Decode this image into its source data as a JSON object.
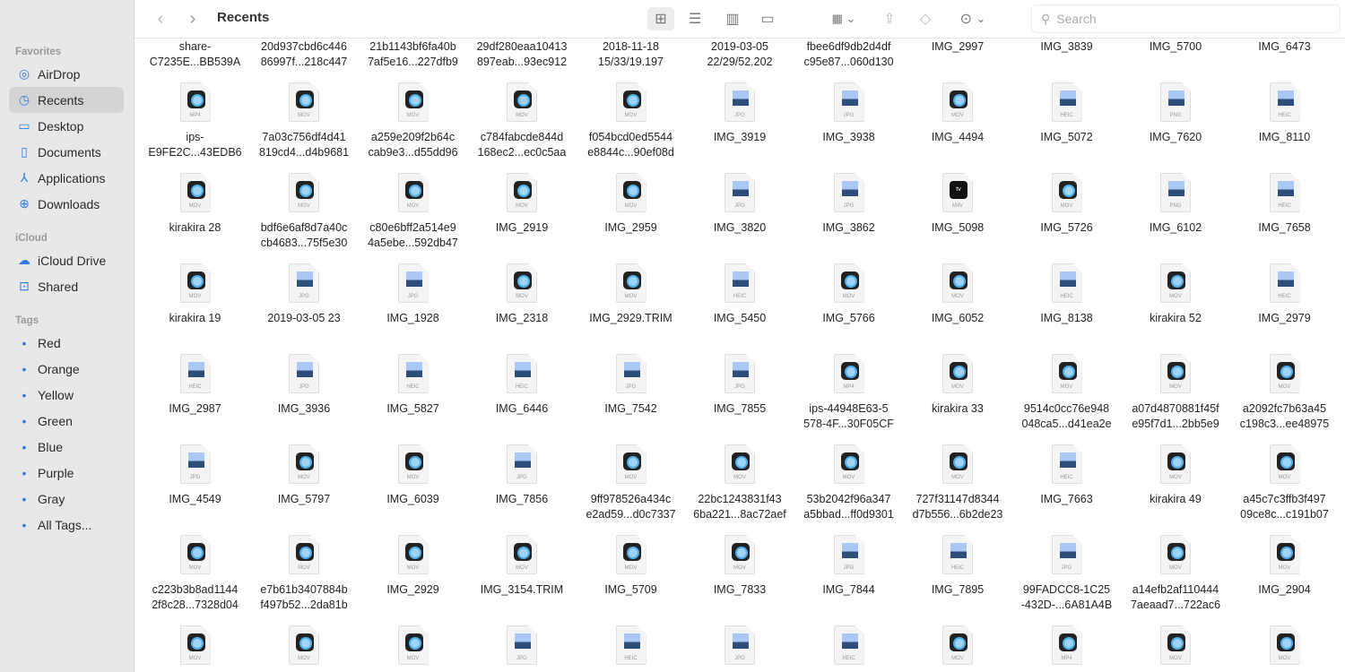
{
  "toolbar": {
    "title": "Recents",
    "search_placeholder": "Search"
  },
  "sidebar": {
    "favorites_label": "Favorites",
    "favorites": [
      {
        "label": "AirDrop",
        "icon": "airdrop-icon"
      },
      {
        "label": "Recents",
        "icon": "clock-icon",
        "selected": true
      },
      {
        "label": "Desktop",
        "icon": "desktop-icon"
      },
      {
        "label": "Documents",
        "icon": "document-icon"
      },
      {
        "label": "Applications",
        "icon": "applications-icon"
      },
      {
        "label": "Downloads",
        "icon": "download-icon"
      }
    ],
    "icloud_label": "iCloud",
    "icloud": [
      {
        "label": "iCloud Drive",
        "icon": "cloud-icon"
      },
      {
        "label": "Shared",
        "icon": "shared-folder-icon"
      }
    ],
    "tags_label": "Tags",
    "tags": [
      {
        "label": "Red",
        "color": "#f0443a"
      },
      {
        "label": "Orange",
        "color": "#f29a1b"
      },
      {
        "label": "Yellow",
        "color": "#f4c51d"
      },
      {
        "label": "Green",
        "color": "#2dbb48"
      },
      {
        "label": "Blue",
        "color": "#2f7be6"
      },
      {
        "label": "Purple",
        "color": "#a24fd0"
      },
      {
        "label": "Gray",
        "color": "#8c8c8c"
      },
      {
        "label": "All Tags...",
        "color": null
      }
    ]
  },
  "files": [
    [
      {
        "name": [
          "share-",
          "C7235E...BB539A"
        ]
      },
      {
        "name": [
          "20d937cbd6c446",
          "86997f...218c447"
        ]
      },
      {
        "name": [
          "21b1143bf6fa40b",
          "7af5e16...227dfb9"
        ]
      },
      {
        "name": [
          "29df280eaa10413",
          "897eab...93ec912"
        ]
      },
      {
        "name": [
          "2018-11-18",
          "15/33/19.197"
        ]
      },
      {
        "name": [
          "2019-03-05",
          "22/29/52.202"
        ]
      },
      {
        "name": [
          "fbee6df9db2d4df",
          "c95e87...060d130"
        ]
      },
      {
        "name": [
          "IMG_2997"
        ]
      },
      {
        "name": [
          "IMG_3839"
        ]
      },
      {
        "name": [
          "IMG_5700"
        ]
      },
      {
        "name": [
          "IMG_6473"
        ]
      }
    ],
    [
      {
        "name": [
          "ips-",
          "E9FE2C...43EDB6"
        ],
        "type": "MP4"
      },
      {
        "name": [
          "7a03c756df4d41",
          "819cd4...d4b9681"
        ],
        "type": "MOV"
      },
      {
        "name": [
          "a259e209f2b64c",
          "cab9e3...d55dd96"
        ],
        "type": "MOV"
      },
      {
        "name": [
          "c784fabcde844d",
          "168ec2...ec0c5aa"
        ],
        "type": "MOV"
      },
      {
        "name": [
          "f054bcd0ed5544",
          "e8844c...90ef08d"
        ],
        "type": "MOV"
      },
      {
        "name": [
          "IMG_3919"
        ],
        "type": "JPG"
      },
      {
        "name": [
          "IMG_3938"
        ],
        "type": "JPG"
      },
      {
        "name": [
          "IMG_4494"
        ],
        "type": "MOV"
      },
      {
        "name": [
          "IMG_5072"
        ],
        "type": "HEIC"
      },
      {
        "name": [
          "IMG_7620"
        ],
        "type": "PNG"
      },
      {
        "name": [
          "IMG_8110"
        ],
        "type": "HEIC"
      }
    ],
    [
      {
        "name": [
          "kirakira 28"
        ],
        "type": "MOV"
      },
      {
        "name": [
          "bdf6e6af8d7a40c",
          "cb4683...75f5e30"
        ],
        "type": "MOV"
      },
      {
        "name": [
          "c80e6bff2a514e9",
          "4a5ebe...592db47"
        ],
        "type": "MOV"
      },
      {
        "name": [
          "IMG_2919"
        ],
        "type": "MOV"
      },
      {
        "name": [
          "IMG_2959"
        ],
        "type": "MOV"
      },
      {
        "name": [
          "IMG_3820"
        ],
        "type": "JPG"
      },
      {
        "name": [
          "IMG_3862"
        ],
        "type": "JPG"
      },
      {
        "name": [
          "IMG_5098"
        ],
        "type": "M4V"
      },
      {
        "name": [
          "IMG_5726"
        ],
        "type": "MOV"
      },
      {
        "name": [
          "IMG_6102"
        ],
        "type": "PNG"
      },
      {
        "name": [
          "IMG_7658"
        ],
        "type": "HEIC"
      }
    ],
    [
      {
        "name": [
          "kirakira 19"
        ],
        "type": "MOV"
      },
      {
        "name": [
          "2019-03-05 23"
        ],
        "type": "JPG"
      },
      {
        "name": [
          "IMG_1928"
        ],
        "type": "JPG"
      },
      {
        "name": [
          "IMG_2318"
        ],
        "type": "MOV"
      },
      {
        "name": [
          "IMG_2929.TRIM"
        ],
        "type": "MOV"
      },
      {
        "name": [
          "IMG_5450"
        ],
        "type": "HEIC"
      },
      {
        "name": [
          "IMG_5766"
        ],
        "type": "MOV"
      },
      {
        "name": [
          "IMG_6052"
        ],
        "type": "MOV"
      },
      {
        "name": [
          "IMG_8138"
        ],
        "type": "HEIC"
      },
      {
        "name": [
          "kirakira 52"
        ],
        "type": "MOV"
      },
      {
        "name": [
          "IMG_2979"
        ],
        "type": "HEIC"
      }
    ],
    [
      {
        "name": [
          "IMG_2987"
        ],
        "type": "HEIC"
      },
      {
        "name": [
          "IMG_3936"
        ],
        "type": "JPG"
      },
      {
        "name": [
          "IMG_5827"
        ],
        "type": "HEIC"
      },
      {
        "name": [
          "IMG_6446"
        ],
        "type": "HEIC"
      },
      {
        "name": [
          "IMG_7542"
        ],
        "type": "JPG"
      },
      {
        "name": [
          "IMG_7855"
        ],
        "type": "JPG"
      },
      {
        "name": [
          "ips-44948E63-5",
          "578-4F...30F05CF"
        ],
        "type": "MP4"
      },
      {
        "name": [
          "kirakira 33"
        ],
        "type": "MOV"
      },
      {
        "name": [
          "9514c0cc76e948",
          "048ca5...d41ea2e"
        ],
        "type": "MOV"
      },
      {
        "name": [
          "a07d4870881f45f",
          "e95f7d1...2bb5e9"
        ],
        "type": "MOV"
      },
      {
        "name": [
          "a2092fc7b63a45",
          "c198c3...ee48975"
        ],
        "type": "MOV"
      }
    ],
    [
      {
        "name": [
          "IMG_4549"
        ],
        "type": "JPG"
      },
      {
        "name": [
          "IMG_5797"
        ],
        "type": "MOV"
      },
      {
        "name": [
          "IMG_6039"
        ],
        "type": "MOV"
      },
      {
        "name": [
          "IMG_7856"
        ],
        "type": "JPG"
      },
      {
        "name": [
          "9ff978526a434c",
          "e2ad59...d0c7337"
        ],
        "type": "MOV"
      },
      {
        "name": [
          "22bc1243831f43",
          "6ba221...8ac72aef"
        ],
        "type": "MOV"
      },
      {
        "name": [
          "53b2042f96a347",
          "a5bbad...ff0d9301"
        ],
        "type": "MOV"
      },
      {
        "name": [
          "727f31147d8344",
          "d7b556...6b2de23"
        ],
        "type": "MOV"
      },
      {
        "name": [
          "IMG_7663"
        ],
        "type": "HEIC"
      },
      {
        "name": [
          "kirakira 49"
        ],
        "type": "MOV"
      },
      {
        "name": [
          "a45c7c3ffb3f497",
          "09ce8c...c191b07"
        ],
        "type": "MOV"
      }
    ],
    [
      {
        "name": [
          "c223b3b8ad1144",
          "2f8c28...7328d04"
        ],
        "type": "MOV"
      },
      {
        "name": [
          "e7b61b3407884b",
          "f497b52...2da81b"
        ],
        "type": "MOV"
      },
      {
        "name": [
          "IMG_2929"
        ],
        "type": "MOV"
      },
      {
        "name": [
          "IMG_3154.TRIM"
        ],
        "type": "MOV"
      },
      {
        "name": [
          "IMG_5709"
        ],
        "type": "MOV"
      },
      {
        "name": [
          "IMG_7833"
        ],
        "type": "MOV"
      },
      {
        "name": [
          "IMG_7844"
        ],
        "type": "JPG"
      },
      {
        "name": [
          "IMG_7895"
        ],
        "type": "HEIC"
      },
      {
        "name": [
          "99FADCC8-1C25",
          "-432D-...6A81A4B"
        ],
        "type": "JPG"
      },
      {
        "name": [
          "a14efb2af110444",
          "7aeaad7...722ac6"
        ],
        "type": "MOV"
      },
      {
        "name": [
          "IMG_2904"
        ],
        "type": "MOV"
      }
    ],
    [
      {
        "type": "MOV"
      },
      {
        "type": "MOV"
      },
      {
        "type": "MOV"
      },
      {
        "type": "JPG"
      },
      {
        "type": "HEIC"
      },
      {
        "type": "JPG"
      },
      {
        "type": "HEIC"
      },
      {
        "type": "MOV"
      },
      {
        "type": "MP4"
      },
      {
        "type": "MOV"
      },
      {
        "type": "MOV"
      }
    ]
  ]
}
